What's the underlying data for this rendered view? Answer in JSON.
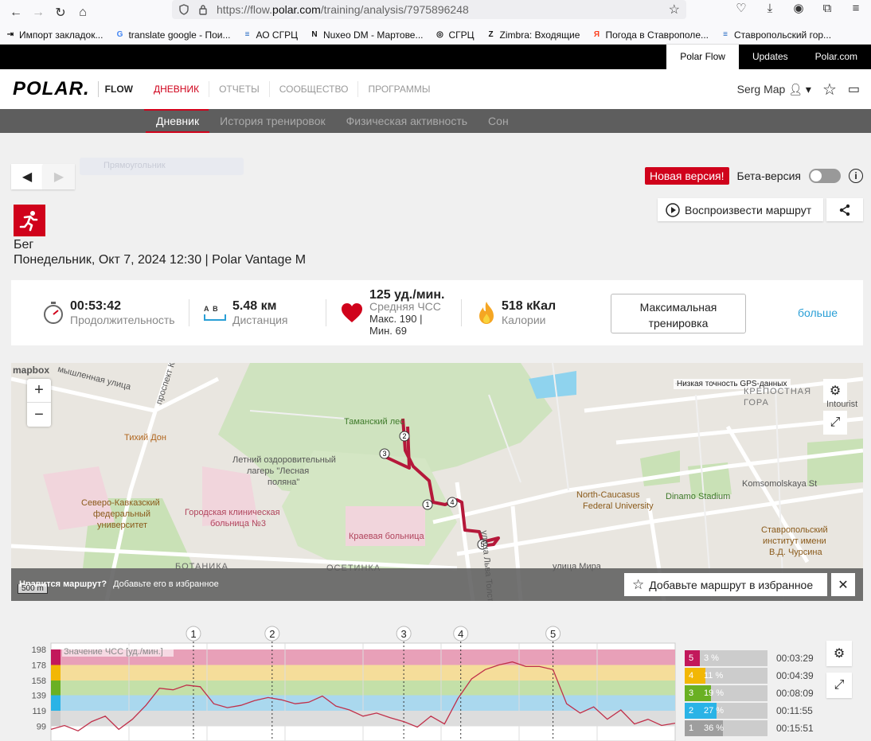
{
  "browser": {
    "url_prefix": "https://flow.",
    "url_domain": "polar.com",
    "url_path": "/training/analysis/7975896248",
    "bookmarks": [
      {
        "icon": "import-icon",
        "label": "Импорт закладок..."
      },
      {
        "icon": "google-icon",
        "label": "translate google - Пои..."
      },
      {
        "icon": "srgc-icon",
        "label": "АО СГРЦ"
      },
      {
        "icon": "nuxeo-icon",
        "label": "Nuxeo DM - Мартове..."
      },
      {
        "icon": "globe-icon",
        "label": "СГРЦ"
      },
      {
        "icon": "zimbra-icon",
        "label": "Zimbra: Входящие"
      },
      {
        "icon": "yandex-icon",
        "label": "Погода в Ставрополе..."
      },
      {
        "icon": "srgc-icon",
        "label": "Ставропольский гор..."
      }
    ]
  },
  "topbar": {
    "links": [
      "Polar Flow",
      "Updates",
      "Polar.com"
    ]
  },
  "header": {
    "logo": "POLAR.",
    "flow": "FLOW",
    "nav": [
      "ДНЕВНИК",
      "ОТЧЕТЫ",
      "СООБЩЕСТВО",
      "ПРОГРАММЫ"
    ],
    "user": "Serg Map"
  },
  "subnav": [
    "Дневник",
    "История тренировок",
    "Физическая активность",
    "Сон"
  ],
  "page": {
    "ghost_chip": "Прямоугольник",
    "new_version": "Новая версия!",
    "beta": "Бета-версия",
    "replay": "Воспроизвести маршрут",
    "sport": "Бег",
    "date": "Понедельник, Окт 7, 2024 12:30 | Polar Vantage M"
  },
  "summary": {
    "duration_value": "00:53:42",
    "duration_label": "Продолжительность",
    "distance_value": "5.48 км",
    "distance_label": "Дистанция",
    "distance_ab": "A  B",
    "hr_value": "125 уд./мин.",
    "hr_label": "Средняя ЧСС",
    "hr_max": "Макс. 190  |",
    "hr_min": "Мин. 69",
    "calories_value": "518 кКал",
    "calories_label": "Калории",
    "max_button_1": "Максимальная",
    "max_button_2": "тренировка",
    "more": "больше"
  },
  "map": {
    "logo": "mapbox",
    "gps_legend": "Низкая точность GPS-данных",
    "labels": [
      "Тихий Дон",
      "Таманский лес",
      "Летний оздоровительный",
      "лагерь \"Лесная",
      "поляна\"",
      "Северо-Кавказский",
      "федеральный",
      "университет",
      "Городская клиническая",
      "больница №3",
      "Краевая больница",
      "North-Caucasus",
      "Federal University",
      "Dinamo Stadium",
      "Komsomolskaya St",
      "Ставропольский",
      "институт имени",
      "В.Д. Чурсина",
      "КРЕПОСТНАЯ",
      "ГОРА",
      "Intourist",
      "БОТАНИКА",
      "ОСЕТИНКА",
      "улица Мира",
      "улица Льва Толстого",
      "проспект К",
      "мышленная улица"
    ],
    "fav_title": "Нравится маршрут?",
    "fav_text": "Добавьте его в избранное",
    "fav_button": "Добавьте маршрут в избранное",
    "scale": "500 m",
    "laps": [
      "1",
      "2",
      "3",
      "4",
      "5"
    ],
    "route_color": "#b5183a"
  },
  "chart_data": {
    "type": "line",
    "title": "",
    "series_label": "Значение ЧСС [уд./мин.]",
    "y_ticks": [
      198,
      178,
      158,
      139,
      119,
      99
    ],
    "ylim": [
      80,
      198
    ],
    "laps": [
      "1",
      "2",
      "3",
      "4",
      "5"
    ],
    "lap_positions_min": [
      10.5,
      16.3,
      26.0,
      30.2,
      37.0
    ],
    "zones": [
      {
        "zone": "5",
        "color": "#e8a0b8",
        "from": 178,
        "to": 198
      },
      {
        "zone": "4",
        "color": "#f5dd9a",
        "from": 158,
        "to": 178
      },
      {
        "zone": "3",
        "color": "#c4e0a8",
        "from": 139,
        "to": 158
      },
      {
        "zone": "2",
        "color": "#aad8ee",
        "from": 119,
        "to": 139
      },
      {
        "zone": "1",
        "color": "#dddddd",
        "from": 99,
        "to": 119
      }
    ],
    "x_min": [
      0,
      1,
      2,
      3,
      4,
      5,
      6,
      7,
      8,
      9,
      10,
      11,
      12,
      13,
      14,
      15,
      16,
      17,
      18,
      19,
      20,
      21,
      22,
      23,
      24,
      25,
      26,
      27,
      28,
      29,
      30,
      31,
      32,
      33,
      34,
      35,
      36,
      37,
      38,
      39,
      40,
      41,
      42,
      43,
      44,
      45,
      46
    ],
    "hr": [
      95,
      100,
      93,
      105,
      112,
      95,
      108,
      126,
      148,
      146,
      152,
      150,
      128,
      123,
      126,
      132,
      136,
      133,
      128,
      130,
      138,
      125,
      120,
      112,
      116,
      110,
      105,
      98,
      112,
      102,
      135,
      160,
      172,
      178,
      182,
      176,
      176,
      172,
      128,
      116,
      124,
      108,
      120,
      102,
      108,
      100,
      103
    ],
    "x_total_min": 46
  },
  "zone_table": [
    {
      "zone": "5",
      "pct": "3 %",
      "pct_value": 3,
      "time": "00:03:29",
      "color": "#c2185b"
    },
    {
      "zone": "4",
      "pct": "11 %",
      "pct_value": 11,
      "time": "00:04:39",
      "color": "#f2b705"
    },
    {
      "zone": "3",
      "pct": "19 %",
      "pct_value": 19,
      "time": "00:08:09",
      "color": "#6ab023"
    },
    {
      "zone": "2",
      "pct": "27 %",
      "pct_value": 27,
      "time": "00:11:55",
      "color": "#2ab3e6"
    },
    {
      "zone": "1",
      "pct": "36 %",
      "pct_value": 36,
      "time": "00:15:51",
      "color": "#9e9e9e"
    }
  ]
}
